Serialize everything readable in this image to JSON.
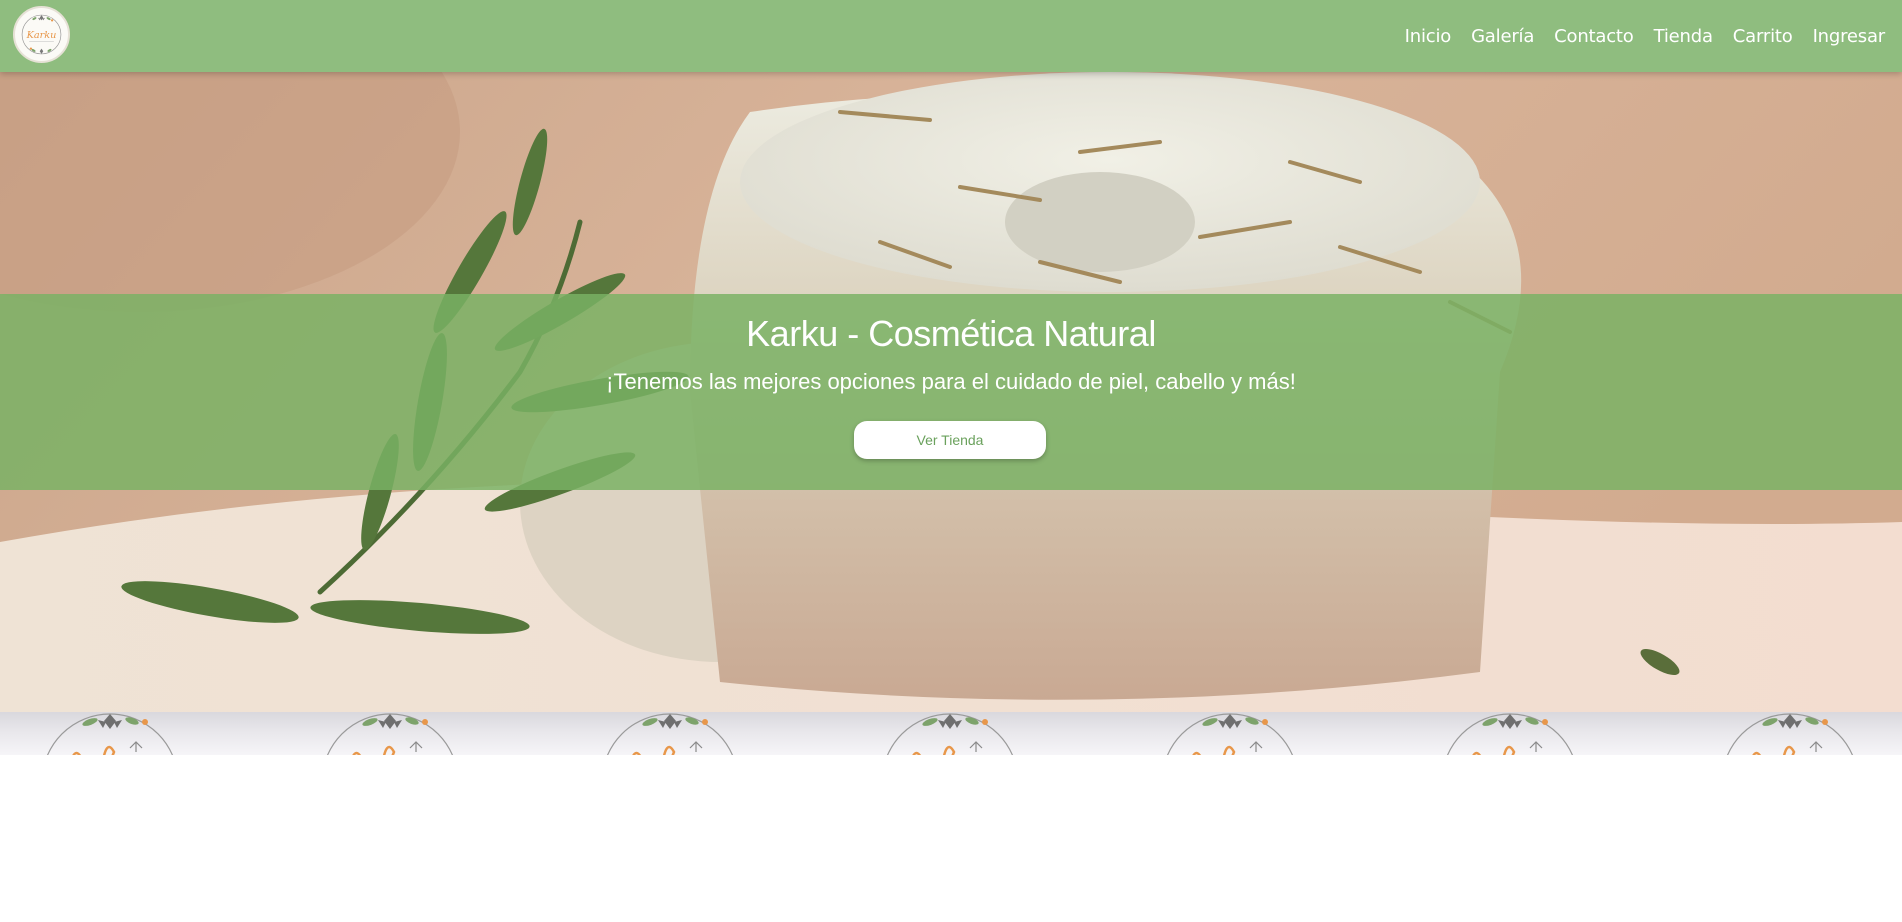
{
  "brand": {
    "name": "Karku",
    "logo_text": "Karku"
  },
  "nav": {
    "items": [
      {
        "label": "Inicio"
      },
      {
        "label": "Galería"
      },
      {
        "label": "Contacto"
      },
      {
        "label": "Tienda"
      },
      {
        "label": "Carrito"
      },
      {
        "label": "Ingresar"
      }
    ]
  },
  "hero": {
    "title": "Karku - Cosmética Natural",
    "subtitle": "¡Tenemos las mejores opciones para el cuidado de piel, cabello y más!",
    "button_label": "Ver Tienda"
  },
  "colors": {
    "navbar": "#8fbd7f",
    "banner": "#7ab264",
    "button_text": "#6aa15c",
    "logo_orange": "#e8974a"
  },
  "icons": {
    "logo": "karku-flower-wreath-logo"
  }
}
